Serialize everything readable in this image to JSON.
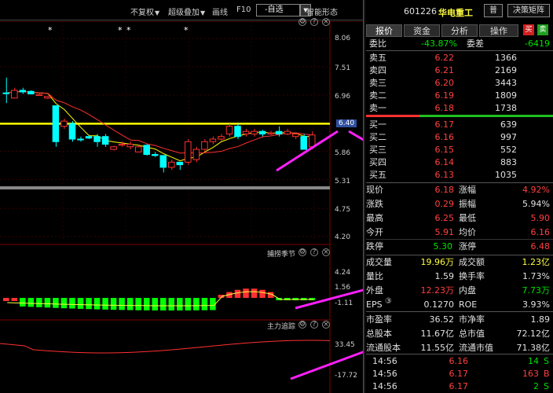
{
  "toolbar": {
    "fuquan": "不复权",
    "overlay": "超级叠加",
    "draw": "画线",
    "f10": "F10",
    "watch": "-自选",
    "smart": "智能形态"
  },
  "chart": {
    "price_axis": [
      "8.06",
      "7.51",
      "6.96",
      "6.40",
      "5.86",
      "5.31",
      "4.75",
      "4.20"
    ],
    "current_price_tag": "6.40",
    "stars": [
      "*",
      "*",
      "*",
      "*"
    ],
    "candles": [
      {
        "o": 7.0,
        "c": 7.0,
        "h": 7.3,
        "l": 6.8,
        "up": false
      },
      {
        "o": 6.9,
        "c": 7.05,
        "h": 7.1,
        "l": 6.9,
        "up": true
      },
      {
        "o": 7.05,
        "c": 7.02,
        "h": 7.1,
        "l": 6.98,
        "up": false
      },
      {
        "o": 7.03,
        "c": 6.98,
        "h": 7.05,
        "l": 6.97,
        "up": false
      },
      {
        "o": 6.95,
        "c": 6.97,
        "h": 7.0,
        "l": 6.95,
        "up": true
      },
      {
        "o": 6.9,
        "c": 6.93,
        "h": 6.93,
        "l": 6.88,
        "up": true
      },
      {
        "o": 6.75,
        "c": 6.05,
        "h": 6.75,
        "l": 5.95,
        "up": false
      },
      {
        "o": 6.35,
        "c": 6.45,
        "h": 6.5,
        "l": 6.3,
        "up": true
      },
      {
        "o": 6.4,
        "c": 6.1,
        "h": 6.45,
        "l": 6.05,
        "up": false
      },
      {
        "o": 6.1,
        "c": 6.1,
        "h": 6.15,
        "l": 6.05,
        "up": false
      },
      {
        "o": 6.15,
        "c": 6.12,
        "h": 6.18,
        "l": 6.1,
        "up": false
      },
      {
        "o": 6.15,
        "c": 6.05,
        "h": 6.2,
        "l": 5.95,
        "up": false
      },
      {
        "o": 6.15,
        "c": 6.0,
        "h": 6.2,
        "l": 5.95,
        "up": false
      },
      {
        "o": 5.9,
        "c": 5.95,
        "h": 5.97,
        "l": 5.88,
        "up": true
      },
      {
        "o": 5.98,
        "c": 6.0,
        "h": 6.05,
        "l": 5.95,
        "up": true
      },
      {
        "o": 5.95,
        "c": 6.0,
        "h": 6.05,
        "l": 5.9,
        "up": true
      },
      {
        "o": 5.85,
        "c": 5.95,
        "h": 5.98,
        "l": 5.85,
        "up": true
      },
      {
        "o": 5.98,
        "c": 5.8,
        "h": 6.0,
        "l": 5.78,
        "up": false
      },
      {
        "o": 5.8,
        "c": 5.78,
        "h": 5.85,
        "l": 5.75,
        "up": false
      },
      {
        "o": 5.78,
        "c": 5.55,
        "h": 5.78,
        "l": 5.45,
        "up": false
      },
      {
        "o": 5.55,
        "c": 5.65,
        "h": 5.7,
        "l": 5.5,
        "up": true
      },
      {
        "o": 5.65,
        "c": 5.6,
        "h": 5.65,
        "l": 5.5,
        "up": false
      },
      {
        "o": 5.65,
        "c": 6.05,
        "h": 6.1,
        "l": 5.6,
        "up": true
      },
      {
        "o": 5.7,
        "c": 5.9,
        "h": 5.95,
        "l": 5.65,
        "up": true
      },
      {
        "o": 5.9,
        "c": 6.05,
        "h": 6.1,
        "l": 5.85,
        "up": true
      },
      {
        "o": 6.05,
        "c": 6.1,
        "h": 6.15,
        "l": 6.0,
        "up": true
      },
      {
        "o": 6.1,
        "c": 6.15,
        "h": 6.2,
        "l": 6.05,
        "up": true
      },
      {
        "o": 6.2,
        "c": 6.35,
        "h": 6.4,
        "l": 6.15,
        "up": true
      },
      {
        "o": 6.35,
        "c": 6.15,
        "h": 6.4,
        "l": 6.1,
        "up": false
      },
      {
        "o": 6.2,
        "c": 6.25,
        "h": 6.3,
        "l": 6.15,
        "up": true
      },
      {
        "o": 6.2,
        "c": 6.25,
        "h": 6.3,
        "l": 6.15,
        "up": true
      },
      {
        "o": 6.25,
        "c": 6.2,
        "h": 6.28,
        "l": 6.15,
        "up": false
      },
      {
        "o": 6.2,
        "c": 6.22,
        "h": 6.26,
        "l": 6.18,
        "up": true
      },
      {
        "o": 6.25,
        "c": 6.2,
        "h": 6.35,
        "l": 6.15,
        "up": false
      },
      {
        "o": 6.2,
        "c": 6.25,
        "h": 6.3,
        "l": 6.18,
        "up": true
      },
      {
        "o": 6.15,
        "c": 6.2,
        "h": 6.22,
        "l": 6.1,
        "up": true
      },
      {
        "o": 6.15,
        "c": 5.9,
        "h": 6.2,
        "l": 5.9,
        "up": false
      },
      {
        "o": 5.95,
        "c": 6.18,
        "h": 6.25,
        "l": 5.9,
        "up": true
      }
    ],
    "ind1": {
      "name": "捕捞季节",
      "axis": [
        "4.24",
        "1.56",
        "-1.11"
      ]
    },
    "ind2": {
      "name": "主力追踪",
      "axis": [
        "33.45",
        "-17.72"
      ]
    }
  },
  "header": {
    "code": "601226",
    "name": "华电重工",
    "btn1": "普",
    "btn2": "决策矩阵"
  },
  "tabs": [
    "报价",
    "资金",
    "分析",
    "操作"
  ],
  "tab_icons": {
    "buy": "买",
    "sell": "卖"
  },
  "wb": {
    "label": "委比",
    "value": "-43.87%",
    "diff_label": "委差",
    "diff": "-6419"
  },
  "asks": [
    {
      "label": "卖五",
      "price": "6.22",
      "vol": "1366"
    },
    {
      "label": "卖四",
      "price": "6.21",
      "vol": "2169"
    },
    {
      "label": "卖三",
      "price": "6.20",
      "vol": "3443"
    },
    {
      "label": "卖二",
      "price": "6.19",
      "vol": "1809"
    },
    {
      "label": "卖一",
      "price": "6.18",
      "vol": "1738"
    }
  ],
  "bids": [
    {
      "label": "买一",
      "price": "6.17",
      "vol": "639"
    },
    {
      "label": "买二",
      "price": "6.16",
      "vol": "997"
    },
    {
      "label": "买三",
      "price": "6.15",
      "vol": "552"
    },
    {
      "label": "买四",
      "price": "6.14",
      "vol": "883"
    },
    {
      "label": "买五",
      "price": "6.13",
      "vol": "1035"
    }
  ],
  "stats1": [
    {
      "l1": "现价",
      "v1": "6.18",
      "c1": "red",
      "l2": "涨幅",
      "v2": "4.92%",
      "c2": "red"
    },
    {
      "l1": "涨跌",
      "v1": "0.29",
      "c1": "red",
      "l2": "振幅",
      "v2": "5.94%",
      "c2": "white"
    },
    {
      "l1": "最高",
      "v1": "6.25",
      "c1": "red",
      "l2": "最低",
      "v2": "5.90",
      "c2": "red"
    },
    {
      "l1": "今开",
      "v1": "5.91",
      "c1": "red",
      "l2": "均价",
      "v2": "6.16",
      "c2": "red"
    }
  ],
  "limit": {
    "l1": "跌停",
    "v1": "5.30",
    "l2": "涨停",
    "v2": "6.48"
  },
  "stats2": [
    {
      "l1": "成交量",
      "v1": "19.96万",
      "c1": "yellow",
      "l2": "成交额",
      "v2": "1.23亿",
      "c2": "yellow"
    },
    {
      "l1": "量比",
      "v1": "1.59",
      "c1": "white",
      "l2": "换手率",
      "v2": "1.73%",
      "c2": "white"
    },
    {
      "l1": "外盘",
      "v1": "12.23万",
      "c1": "red",
      "l2": "内盘",
      "v2": "7.73万",
      "c2": "green"
    },
    {
      "l1": "EPS",
      "v1": "0.1270",
      "c1": "white",
      "l2": "ROE",
      "v2": "3.93%",
      "c2": "white"
    }
  ],
  "eps_icon": "③",
  "stats3": [
    {
      "l1": "市盈率",
      "v1": "36.52",
      "l2": "市净率",
      "v2": "1.89"
    },
    {
      "l1": "总股本",
      "v1": "11.67亿",
      "l2": "总市值",
      "v2": "72.12亿"
    },
    {
      "l1": "流通股本",
      "v1": "11.55亿",
      "l2": "流通市值",
      "v2": "71.38亿"
    }
  ],
  "ticks": [
    {
      "time": "14:56",
      "price": "6.16",
      "vol": "14",
      "dir": "S"
    },
    {
      "time": "14:56",
      "price": "6.17",
      "vol": "163",
      "dir": "B"
    },
    {
      "time": "14:56",
      "price": "6.17",
      "vol": "2",
      "dir": "S"
    }
  ]
}
